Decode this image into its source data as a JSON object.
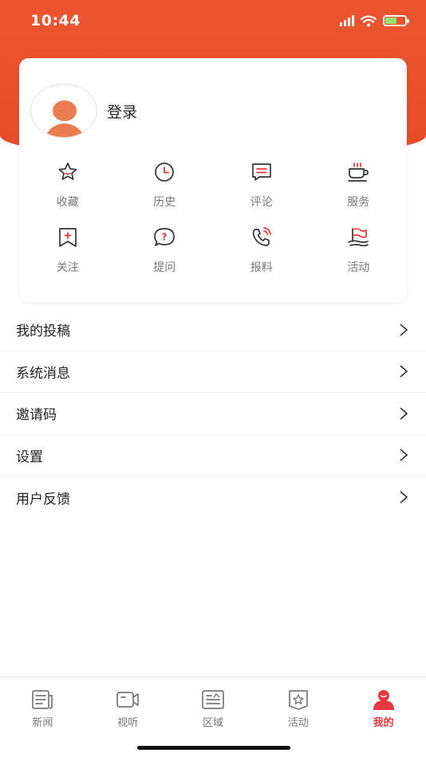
{
  "status_bar": {
    "time": "10:44"
  },
  "profile": {
    "login_label": "登录"
  },
  "shortcuts": [
    {
      "label": "收藏",
      "icon": "star-icon"
    },
    {
      "label": "历史",
      "icon": "clock-icon"
    },
    {
      "label": "评论",
      "icon": "comment-icon"
    },
    {
      "label": "服务",
      "icon": "cup-icon"
    },
    {
      "label": "关注",
      "icon": "bookmark-plus-icon"
    },
    {
      "label": "提问",
      "icon": "question-bubble-icon"
    },
    {
      "label": "报料",
      "icon": "phone-icon"
    },
    {
      "label": "活动",
      "icon": "flag-icon"
    }
  ],
  "menu": [
    {
      "label": "我的投稿"
    },
    {
      "label": "系统消息"
    },
    {
      "label": "邀请码"
    },
    {
      "label": "设置"
    },
    {
      "label": "用户反馈"
    }
  ],
  "tabs": [
    {
      "label": "新闻",
      "icon": "newspaper-icon"
    },
    {
      "label": "视听",
      "icon": "video-icon"
    },
    {
      "label": "区域",
      "icon": "region-icon"
    },
    {
      "label": "活动",
      "icon": "star-badge-icon"
    },
    {
      "label": "我的",
      "icon": "profile-icon",
      "active": true
    }
  ],
  "colors": {
    "accent": "#e9512c",
    "active_tab": "#e3383e",
    "icon_red": "#e53935",
    "icon_dark": "#333333"
  }
}
